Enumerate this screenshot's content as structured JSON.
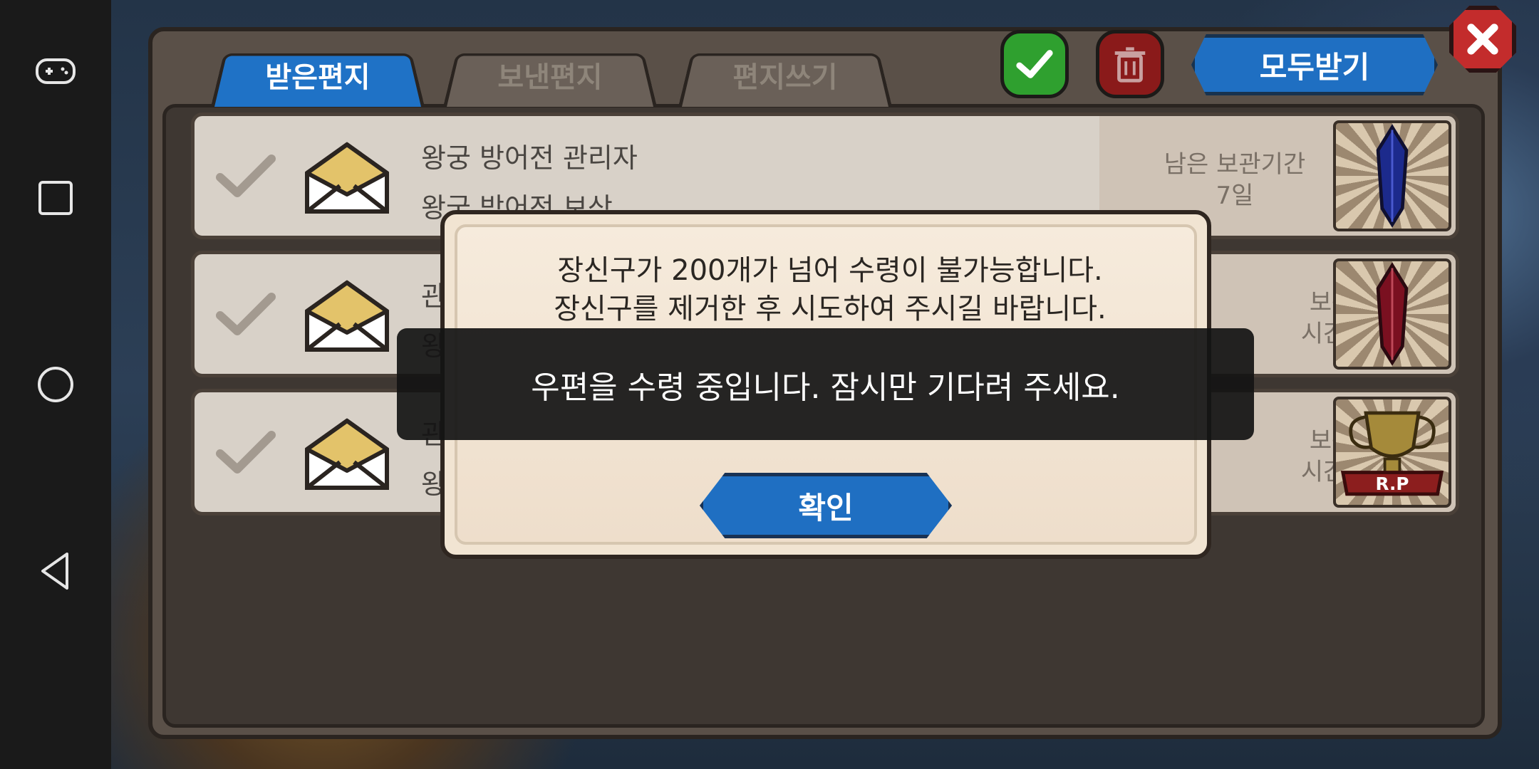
{
  "tabs": {
    "received": "받은편지",
    "sent": "보낸편지",
    "compose": "편지쓰기"
  },
  "actions": {
    "receive_all": "모두받기"
  },
  "mail_rows": [
    {
      "sender": "왕궁 방어전 관리자",
      "title": "왕궁 방어전 보상",
      "remaining_label": "남은 보관기간",
      "remaining_value": "7일"
    },
    {
      "sender": "관",
      "title": "왕",
      "remaining_label": "보관기간",
      "remaining_value": "시간49분"
    },
    {
      "sender": "관",
      "title": "왕",
      "remaining_label": "보관기간",
      "remaining_value": "시간49분"
    }
  ],
  "popup": {
    "line1": "장신구가 200개가 넘어 수령이 불가능합니다.",
    "line2": "장신구를 제거한 후 시도하여 주시길 바랍니다.",
    "confirm": "확인"
  },
  "toast": {
    "message": "우편을 수령 중입니다. 잠시만 기다려 주세요."
  },
  "colors": {
    "tab_active": "#1f72c6",
    "confirm_button": "#1f6fc2",
    "check_button": "#2fa02f",
    "delete_button": "#8a1a1a",
    "close_button": "#c32c2c"
  }
}
